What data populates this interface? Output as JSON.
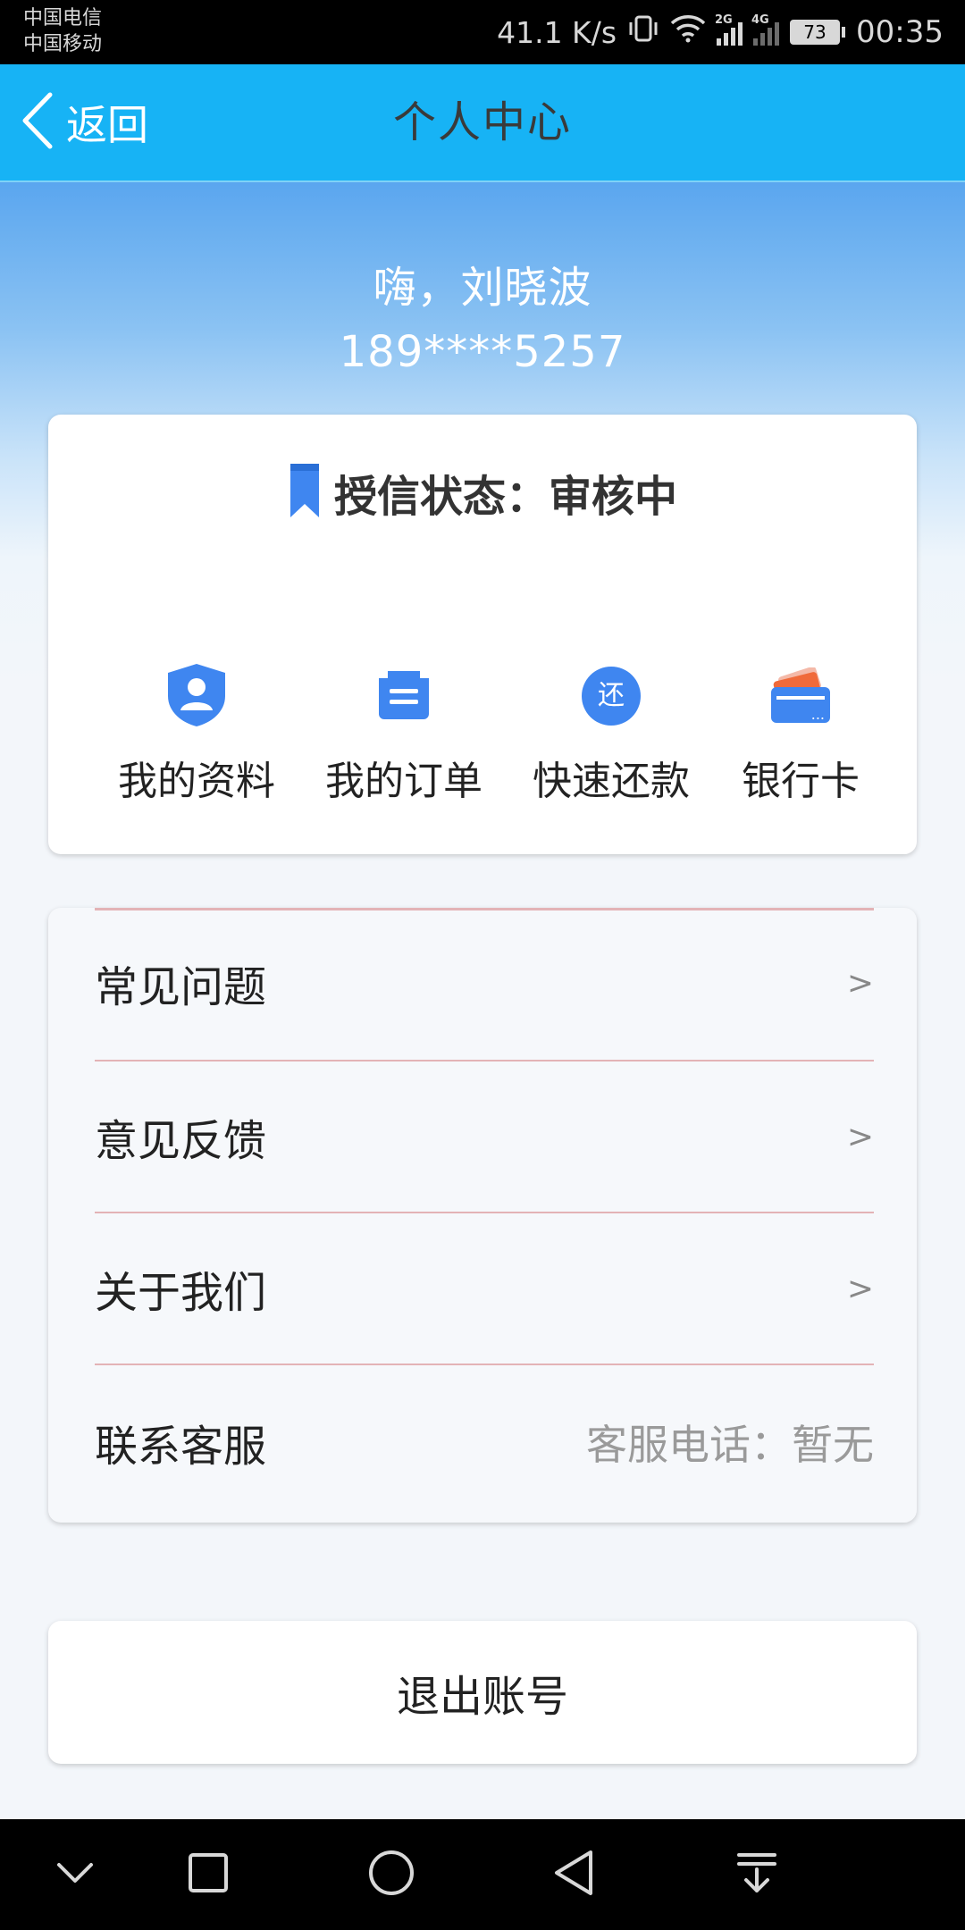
{
  "status_bar": {
    "carrier_1": "中国电信",
    "carrier_2": "中国移动",
    "net_speed": "41.1 K/s",
    "signal_1_tag": "2G",
    "signal_2_tag": "4G",
    "battery": "73",
    "time": "00:35"
  },
  "header": {
    "back_label": "返回",
    "title": "个人中心",
    "bg_color": "#17b3f5"
  },
  "user": {
    "greeting": "嗨，刘晓波",
    "phone": "189****5257"
  },
  "credit": {
    "status_text": "授信状态：审核中",
    "icon": "bookmark-icon"
  },
  "quick_actions": [
    {
      "label": "我的资料",
      "icon": "profile-shield-icon"
    },
    {
      "label": "我的订单",
      "icon": "order-icon"
    },
    {
      "label": "快速还款",
      "icon": "repay-icon",
      "glyph": "还"
    },
    {
      "label": "银行卡",
      "icon": "bank-card-icon",
      "glyph": "..."
    }
  ],
  "menu": {
    "faq": {
      "label": "常见问题",
      "chevron": ">"
    },
    "feedback": {
      "label": "意见反馈",
      "chevron": ">"
    },
    "about": {
      "label": "关于我们",
      "chevron": ">"
    },
    "contact": {
      "label": "联系客服",
      "value": "客服电话：暂无"
    }
  },
  "logout_label": "退出账号",
  "nav": [
    "chevron-down-icon",
    "square-icon",
    "home-circle-icon",
    "back-triangle-icon",
    "download-icon"
  ]
}
